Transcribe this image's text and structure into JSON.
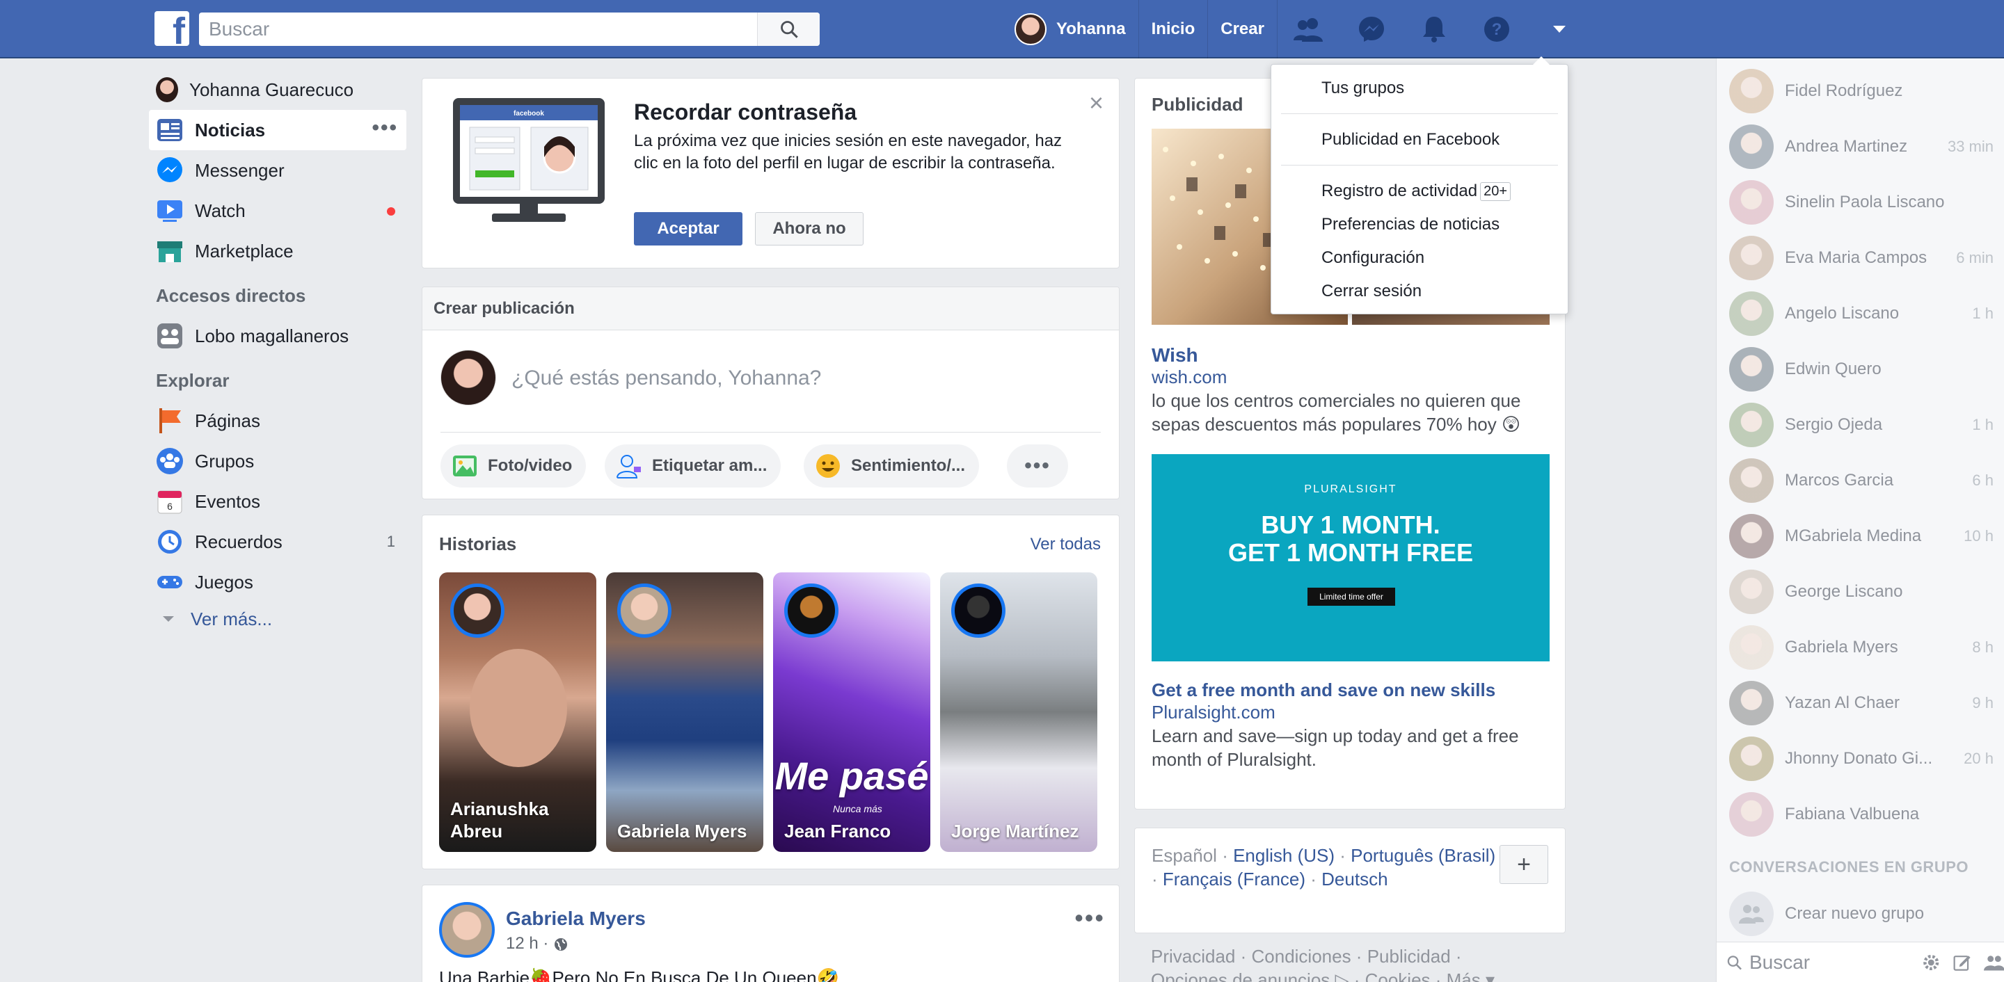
{
  "topbar": {
    "logo_letter": "f",
    "search_placeholder": "Buscar",
    "user_name": "Yohanna",
    "links": [
      "Inicio",
      "Crear"
    ]
  },
  "left_nav": {
    "profile_name": "Yohanna Guarecuco",
    "items": [
      {
        "label": "Noticias",
        "icon": "news-feed-icon",
        "color": "#4267b2"
      },
      {
        "label": "Messenger",
        "icon": "messenger-icon",
        "color": "#0084ff"
      },
      {
        "label": "Watch",
        "icon": "watch-icon",
        "color": "#3b82f6"
      },
      {
        "label": "Marketplace",
        "icon": "marketplace-icon",
        "color": "#2aa39a"
      }
    ],
    "shortcuts_heading": "Accesos directos",
    "shortcuts": [
      {
        "label": "Lobo magallaneros",
        "icon": "group-icon"
      }
    ],
    "explore_heading": "Explorar",
    "explore": [
      {
        "label": "Páginas",
        "icon": "pages-flag-icon",
        "color": "#f36b2d"
      },
      {
        "label": "Grupos",
        "icon": "groups-icon",
        "color": "#3578e5"
      },
      {
        "label": "Eventos",
        "icon": "events-calendar-icon",
        "color": "#e0245e"
      },
      {
        "label": "Recuerdos",
        "icon": "memories-clock-icon",
        "color": "#3578e5"
      },
      {
        "label": "Juegos",
        "icon": "games-controller-icon",
        "color": "#3578e5"
      }
    ],
    "memories_count": "1",
    "see_more": "Ver más..."
  },
  "remember_card": {
    "title": "Recordar contraseña",
    "text": "La próxima vez que inicies sesión en este navegador, haz clic en la foto del perfil en lugar de escribir la contraseña.",
    "monitor_label": "facebook",
    "accept": "Aceptar",
    "decline": "Ahora no"
  },
  "create_post": {
    "heading": "Crear publicación",
    "placeholder": "¿Qué estás pensando, Yohanna?",
    "actions": [
      "Foto/video",
      "Etiquetar am...",
      "Sentimiento/..."
    ]
  },
  "stories": {
    "heading": "Historias",
    "see_all": "Ver todas",
    "items": [
      {
        "name": "Arianushka Abreu"
      },
      {
        "name": "Gabriela Myers"
      },
      {
        "name": "Jean Franco",
        "overlay": "Me pasé",
        "overlay_small": "Nunca más"
      },
      {
        "name": "Jorge Martínez"
      }
    ]
  },
  "post": {
    "author": "Gabriela Myers",
    "time": "12 h ·",
    "text": "Una Barbie🍓Pero No En Busca De Un Queen🤣"
  },
  "ads": {
    "heading": "Publicidad",
    "ad1": {
      "name": "Wish",
      "url": "wish.com",
      "desc": "lo que los centros comerciales no quieren que sepas descuentos más populares 70% hoy 😲"
    },
    "ad2": {
      "logo": "PLURALSIGHT",
      "big_line1": "BUY 1 MONTH.",
      "big_line2": "GET 1 MONTH FREE",
      "offer": "Limited time offer",
      "name": "Get a free month and save on new skills",
      "url": "Pluralsight.com",
      "desc": "Learn and save—sign up today and get a free month of Pluralsight."
    }
  },
  "languages": {
    "current": "Español",
    "options": [
      "English (US)",
      "Português (Brasil)",
      "Français (France)",
      "Deutsch"
    ],
    "add": "+"
  },
  "footer": {
    "line1": "Privacidad · Condiciones · Publicidad ·",
    "line2": "Opciones de anuncios ▷ · Cookies · Más ▾"
  },
  "dropdown": {
    "items": [
      "Tus grupos",
      "Publicidad en Facebook",
      "Registro de actividad",
      "Preferencias de noticias",
      "Configuración",
      "Cerrar sesión"
    ],
    "activity_badge": "20+"
  },
  "chat": {
    "contacts": [
      {
        "name": "Fidel Rodríguez",
        "time": "",
        "color": "#c8a27a"
      },
      {
        "name": "Andrea Martinez",
        "time": "33 min",
        "color": "#5a6b7a"
      },
      {
        "name": "Sinelin Paola Liscano",
        "time": "",
        "color": "#d39aa8"
      },
      {
        "name": "Eva Maria Campos",
        "time": "6 min",
        "color": "#b89a80"
      },
      {
        "name": "Angelo Liscano",
        "time": "1 h",
        "color": "#8aa07a"
      },
      {
        "name": "Edwin Quero",
        "time": "",
        "color": "#4e5d6a"
      },
      {
        "name": "Sergio Ojeda",
        "time": "1 h",
        "color": "#7e9a6a"
      },
      {
        "name": "Marcos Garcia",
        "time": "6 h",
        "color": "#a08a70"
      },
      {
        "name": "MGabriela Medina",
        "time": "10 h",
        "color": "#6a4a4a"
      },
      {
        "name": "George Liscano",
        "time": "",
        "color": "#c0b0a0"
      },
      {
        "name": "Gabriela Myers",
        "time": "8 h",
        "color": "#e0d0c0"
      },
      {
        "name": "Yazan Al Chaer",
        "time": "9 h",
        "color": "#6a6a6a"
      },
      {
        "name": "Jhonny Donato Gi...",
        "time": "20 h",
        "color": "#9a8a50"
      },
      {
        "name": "Fabiana Valbuena",
        "time": "",
        "color": "#d0a0b0"
      }
    ],
    "group_heading": "CONVERSACIONES EN GRUPO",
    "new_group": "Crear nuevo grupo",
    "search_placeholder": "Buscar"
  }
}
